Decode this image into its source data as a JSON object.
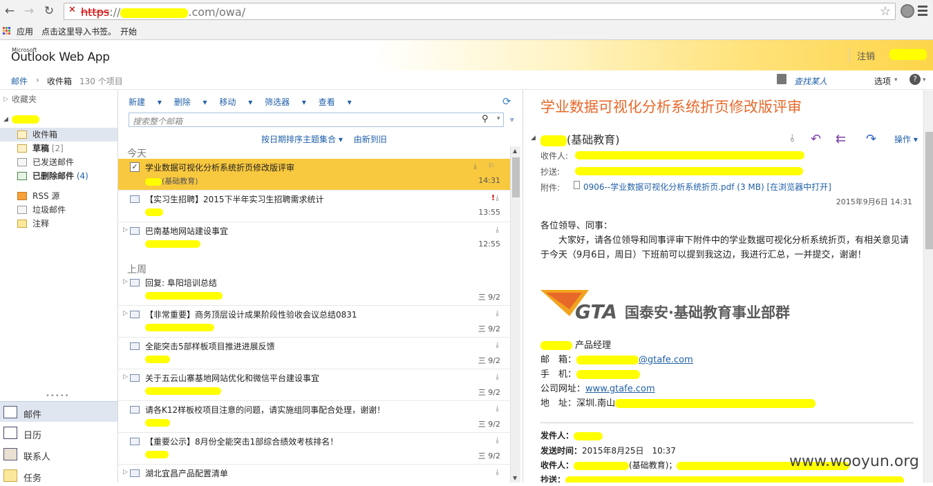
{
  "browser": {
    "url_scheme": "https",
    "url_rest": "://",
    "url_path": ".com/owa/",
    "bookmarks": [
      "应用",
      "点击这里导入书签。",
      "开始"
    ]
  },
  "owa": {
    "logo_small": "Microsoft",
    "logo": "Outlook Web App",
    "signout": "注销"
  },
  "breadcrumb": {
    "root": "邮件",
    "folder": "收件箱",
    "count": "130 个项目",
    "find_someone": "查找某人",
    "options": "选项"
  },
  "leftnav": {
    "favorites": "收藏夹",
    "folders": [
      {
        "label": "收件箱",
        "count": ""
      },
      {
        "label": "草稿",
        "count": "[2]"
      },
      {
        "label": "已发送邮件",
        "count": ""
      },
      {
        "label": "已删除邮件",
        "count": "(4)"
      },
      {
        "label": "RSS 源",
        "count": ""
      },
      {
        "label": "垃圾邮件",
        "count": ""
      },
      {
        "label": "注释",
        "count": ""
      }
    ],
    "bottom": [
      "邮件",
      "日历",
      "联系人",
      "任务"
    ]
  },
  "list": {
    "toolbar": [
      "新建",
      "删除",
      "移动",
      "筛选器",
      "查看"
    ],
    "search_placeholder": "搜索整个邮箱",
    "sort": "按日期排序主题集合",
    "order": "由新到旧",
    "groups": [
      "今天",
      "上周"
    ],
    "items": [
      {
        "subject": "学业数据可视化分析系统折页修改版评审",
        "from": "(基础教育)",
        "time": "14:31"
      },
      {
        "subject": "【实习生招聘】2015下半年实习生招聘需求统计",
        "from": "",
        "time": "13:55"
      },
      {
        "subject": "巴南基地网站建设事宜",
        "from": "",
        "time": "12:55"
      },
      {
        "subject": "回复: 阜阳培训总结",
        "from": "",
        "time": "三 9/2"
      },
      {
        "subject": "【非常重要】商务顶层设计成果阶段性验收会议总结0831",
        "from": "",
        "time": "三 9/2"
      },
      {
        "subject": "全能突击5部样板项目推进进展反馈",
        "from": "",
        "time": "三 9/2"
      },
      {
        "subject": "关于五云山寨基地网站优化和微信平台建设事宜",
        "from": "",
        "time": "三 9/2"
      },
      {
        "subject": "请各K12样板校项目注意的问题，请实施组同事配合处理，谢谢！",
        "from": "",
        "time": "三 9/2"
      },
      {
        "subject": "【重要公示】8月份全能突击1部综合绩效考核排名！",
        "from": "",
        "time": "三 9/2"
      },
      {
        "subject": "湖北宜昌产品配置清单",
        "from": "",
        "time": ""
      }
    ]
  },
  "reader": {
    "title": "学业数据可视化分析系统折页修改版评审",
    "sender": "(基础教育)",
    "actions": "操作",
    "to_label": "收件人:",
    "cc_label": "抄送:",
    "att_label": "附件:",
    "attachment": "0906--学业数据可视化分析系统折页.pdf (3 MB) [在浏览器中打开]",
    "date": "2015年9月6日 14:31",
    "body1": "各位领导、同事：",
    "body2": "大家好，请各位领导和同事评审下附件中的学业数据可视化分析系统折页，有相关意见请于今天（9月6日，周日）下班前可以提到我这边，我进行汇总，一并提交，谢谢！",
    "logo_gta": "GTA",
    "logo_cn": "国泰安·基础教育事业部群",
    "sig_title": "产品经理",
    "sig_mail_lbl": "邮　箱：",
    "sig_mail": "@gtafe.com",
    "sig_phone_lbl": "手　机：",
    "sig_site_lbl": "公司网址：",
    "sig_site": "www.gtafe.com",
    "sig_addr_lbl": "地　址：",
    "sig_addr": "深圳.南山",
    "fwd_from": "发件人：",
    "fwd_time_lbl": "发送时间：",
    "fwd_time": "2015年8月25日　10:37",
    "fwd_to": "收件人：",
    "fwd_to_val": "(基础教育)；",
    "fwd_cc": "抄送："
  },
  "watermark": "www.wooyun.org"
}
